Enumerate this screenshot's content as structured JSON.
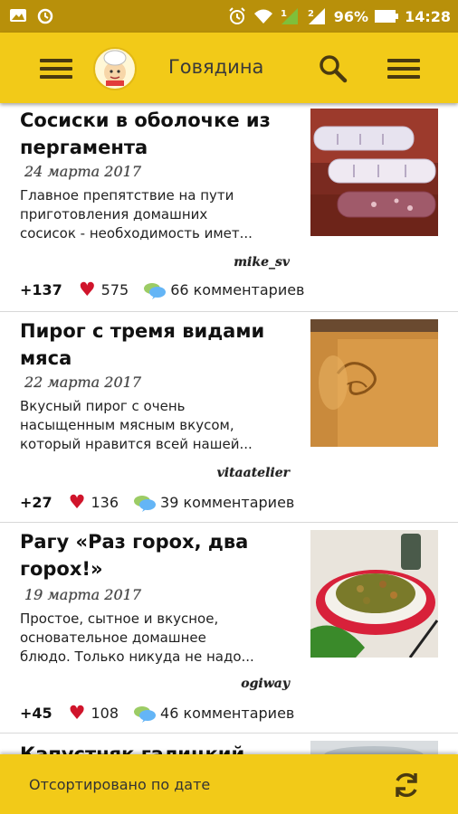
{
  "status_bar": {
    "battery_percent": "96%",
    "time": "14:28"
  },
  "app_bar": {
    "title": "Говядина"
  },
  "recipes": [
    {
      "title_line1": "Сосиски в оболочке из",
      "title_line2": "пергамента",
      "date": "24 марта 2017",
      "desc_line1": "Главное препятствие на пути",
      "desc_line2": "приготовления домашних",
      "desc_line3": "сосисок - необходимость имет...",
      "author": "mike_sv",
      "score": "+137",
      "likes": "575",
      "comments": "66 комментариев"
    },
    {
      "title_line1": "Пирог с тремя видами",
      "title_line2": "мяса",
      "date": "22 марта 2017",
      "desc_line1": "Вкусный пирог с очень",
      "desc_line2": "насыщенным мясным вкусом,",
      "desc_line3": "который нравится всей нашей...",
      "author": "vitaatelier",
      "score": "+27",
      "likes": "136",
      "comments": "39 комментариев"
    },
    {
      "title_line1": "Рагу «Раз горох, два",
      "title_line2": "горох!»",
      "date": "19 марта 2017",
      "desc_line1": "Простое, сытное и вкусное,",
      "desc_line2": "основательное домашнее",
      "desc_line3": "блюдо. Только никуда не надо...",
      "author": "ogiway",
      "score": "+45",
      "likes": "108",
      "comments": "46 комментариев"
    },
    {
      "title_line1": "Капустняк галицкий"
    }
  ],
  "bottom_bar": {
    "sort_label": "Отсортировано по дате"
  },
  "colors": {
    "accent": "#f2ca18",
    "status_bar": "#b8900a",
    "heart": "#d0142b"
  }
}
